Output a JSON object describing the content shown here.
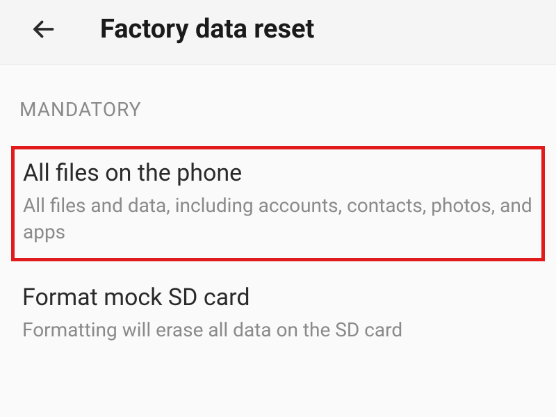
{
  "header": {
    "title": "Factory data reset"
  },
  "section": {
    "label": "MANDATORY"
  },
  "options": [
    {
      "title": "All files on the phone",
      "description": "All files and data, including accounts, contacts, photos, and apps"
    },
    {
      "title": "Format mock SD card",
      "description": "Formatting will erase all data on the SD card"
    }
  ]
}
